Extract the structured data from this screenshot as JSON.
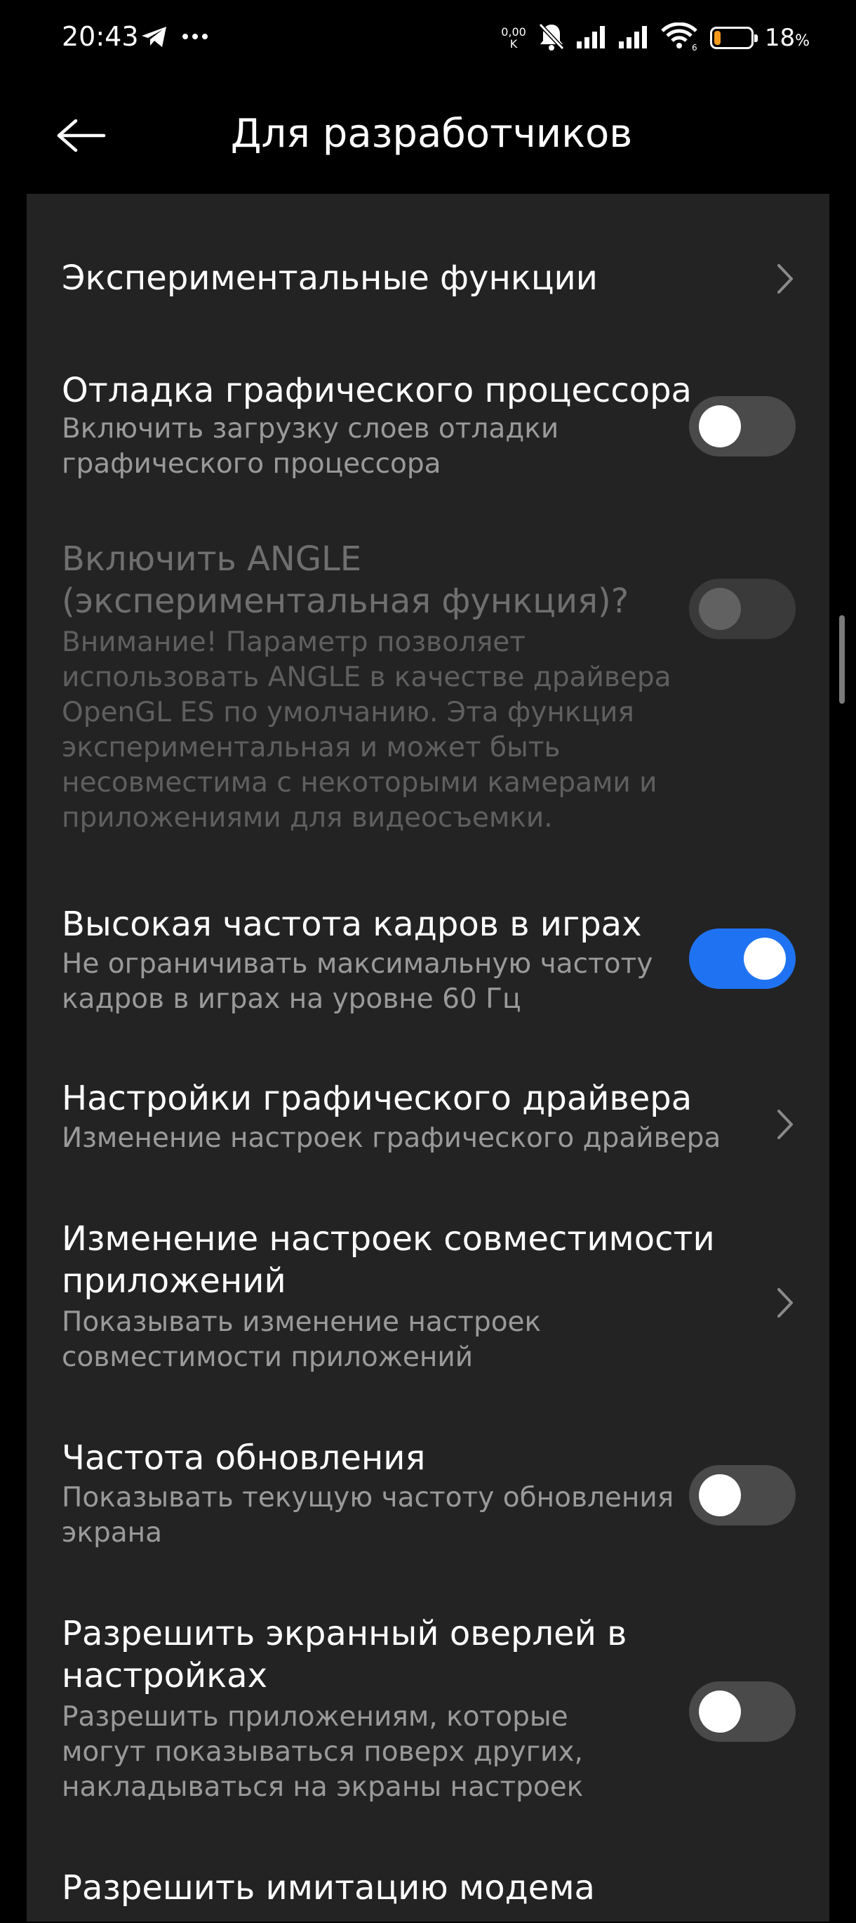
{
  "status_bar": {
    "time": "20:43",
    "net_speed_value": "0,00",
    "net_speed_unit": "K",
    "battery_percent": "18",
    "battery_unit": "%",
    "battery_level": 0.18,
    "battery_color": "#f39a1d",
    "icons": [
      "telegram-icon",
      "more-dots-icon",
      "mute-bell-icon",
      "signal-1-icon",
      "signal-2-icon",
      "wifi-6-icon",
      "battery-icon"
    ]
  },
  "header": {
    "title": "Для разработчиков",
    "back_icon": "arrow-left-icon"
  },
  "accent_color": "#1f73f2",
  "settings": {
    "experimental": {
      "title": "Экспериментальные функции"
    },
    "gpu_debug": {
      "title": "Отладка графического процессора",
      "subtitle_1": "Включить загрузку слоев отладки",
      "subtitle_2": "графического процессора",
      "enabled": false
    },
    "angle": {
      "title_1": "Включить ANGLE",
      "title_2": "(экспериментальная функция)?",
      "subtitle_1": "Внимание! Параметр позволяет",
      "subtitle_2": "использовать ANGLE в качестве драйвера",
      "subtitle_3": "OpenGL ES по умолчанию. Эта функция",
      "subtitle_4": "экспериментальная и может быть",
      "subtitle_5": "несовместима с некоторыми камерами и",
      "subtitle_6": "приложениями для видеосъемки.",
      "enabled": false,
      "disabled": true
    },
    "high_fps": {
      "title": "Высокая частота кадров в играх",
      "subtitle_1": "Не ограничивать максимальную частоту",
      "subtitle_2": "кадров в играх на уровне 60 Гц",
      "enabled": true
    },
    "graphics_driver": {
      "title": "Настройки графического драйвера",
      "subtitle_1": "Изменение настроек графического драйвера"
    },
    "compat": {
      "title_1": "Изменение настроек совместимости",
      "title_2": "приложений",
      "subtitle_1": "Показывать изменение настроек",
      "subtitle_2": "совместимости приложений"
    },
    "refresh_rate": {
      "title": "Частота обновления",
      "subtitle_1": "Показывать текущую частоту обновления",
      "subtitle_2": "экрана",
      "enabled": false
    },
    "overlay": {
      "title_1": "Разрешить экранный оверлей в",
      "title_2": "настройках",
      "subtitle_1": "Разрешить приложениям, которые",
      "subtitle_2": "могут показываться поверх других,",
      "subtitle_3": "накладываться на экраны настроек",
      "enabled": false
    },
    "modem": {
      "title": "Разрешить имитацию модема"
    }
  }
}
